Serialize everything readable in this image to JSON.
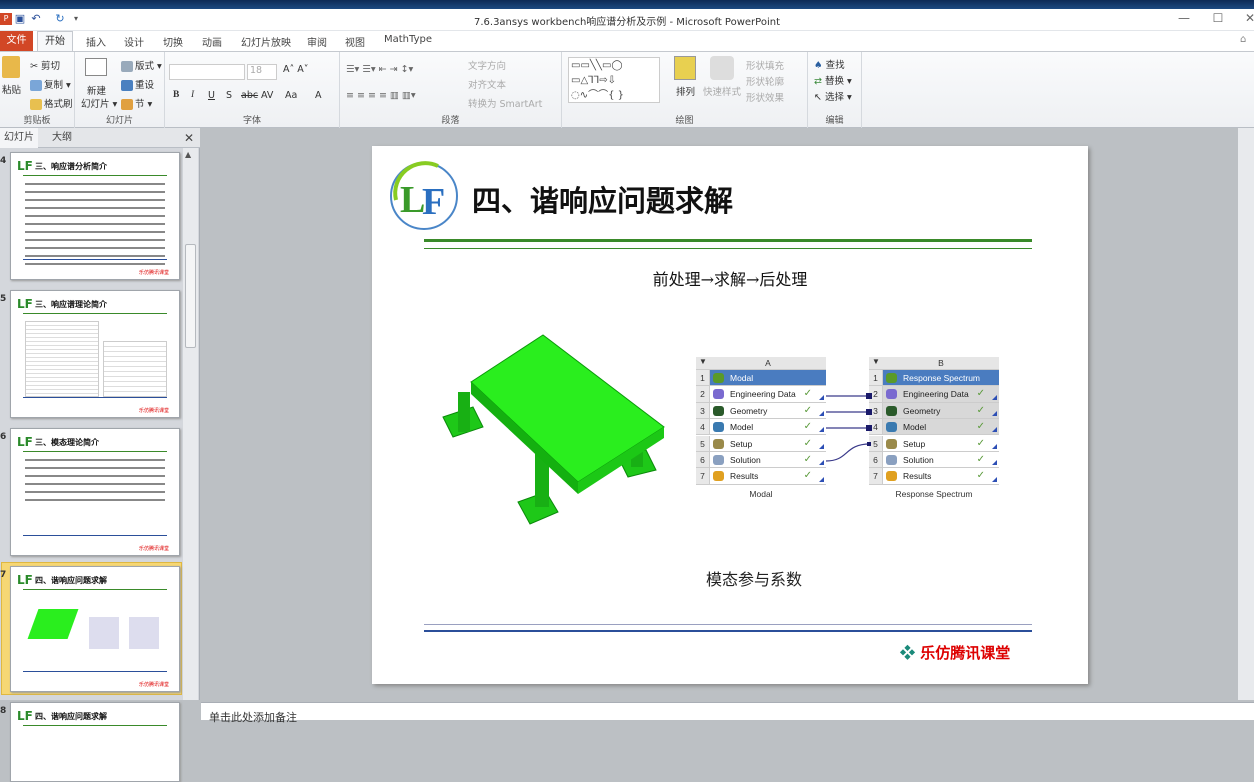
{
  "window": {
    "title": "7.6.3ansys workbench响应谱分析及示例 - Microsoft PowerPoint",
    "minimize": "—",
    "maximize": "☐",
    "close": "✕"
  },
  "tabs": [
    "文件",
    "开始",
    "插入",
    "设计",
    "切换",
    "动画",
    "幻灯片放映",
    "审阅",
    "视图",
    "MathType"
  ],
  "ribbon": {
    "clipboard": {
      "paste": "粘贴",
      "cut": "剪切",
      "copy": "复制",
      "format_painter": "格式刷",
      "label": "剪贴板"
    },
    "slides": {
      "new_slide": "新建",
      "new_slide2": "幻灯片",
      "layout": "版式",
      "reset": "重设",
      "section": "节",
      "label": "幻灯片"
    },
    "font": {
      "size": "18",
      "label": "字体",
      "bold": "B",
      "italic": "I",
      "underline": "U",
      "shadow": "S",
      "strike": "abc",
      "spacing": "AV",
      "case": "Aa",
      "color": "A"
    },
    "paragraph": {
      "text_direction": "文字方向",
      "align_text": "对齐文本",
      "smartart": "转换为 SmartArt",
      "label": "段落"
    },
    "drawing": {
      "arrange": "排列",
      "quick_styles": "快速样式",
      "fill": "形状填充",
      "outline": "形状轮廓",
      "effects": "形状效果",
      "label": "绘图"
    },
    "editing": {
      "find": "查找",
      "replace": "替换",
      "select": "选择",
      "label": "编辑"
    }
  },
  "left_pane": {
    "tabs": [
      "幻灯片",
      "大纲"
    ],
    "close": "✕",
    "thumbs": [
      {
        "num": "4",
        "title": "三、响应谱分析简介"
      },
      {
        "num": "5",
        "title": "三、响应谱理论简介"
      },
      {
        "num": "6",
        "title": "三、模态理论简介"
      },
      {
        "num": "7",
        "title": "四、谐响应问题求解"
      },
      {
        "num": "8",
        "title": "四、谐响应问题求解"
      }
    ],
    "footer": "乐仿腾讯课堂"
  },
  "slide": {
    "logo": "LF",
    "title": "四、谐响应问题求解",
    "subtitle": "前处理→求解→后处理",
    "caption": "模态参与系数",
    "footer": "乐仿腾讯课堂",
    "systems": [
      {
        "col": "A",
        "name": "Modal",
        "caption": "Modal",
        "rows": [
          "Modal",
          "Engineering Data",
          "Geometry",
          "Model",
          "Setup",
          "Solution",
          "Results"
        ]
      },
      {
        "col": "B",
        "name": "Response Spectrum",
        "caption": "Response Spectrum",
        "rows": [
          "Response Spectrum",
          "Engineering Data",
          "Geometry",
          "Model",
          "Setup",
          "Solution",
          "Results"
        ]
      }
    ]
  },
  "notes": {
    "placeholder": "单击此处添加备注"
  },
  "colors": {
    "accent": "#d24726",
    "green": "#3a8a2a",
    "blue_line": "#2b4f9a",
    "wb_header": "#4a7cc0",
    "model_green": "#22e01a"
  }
}
